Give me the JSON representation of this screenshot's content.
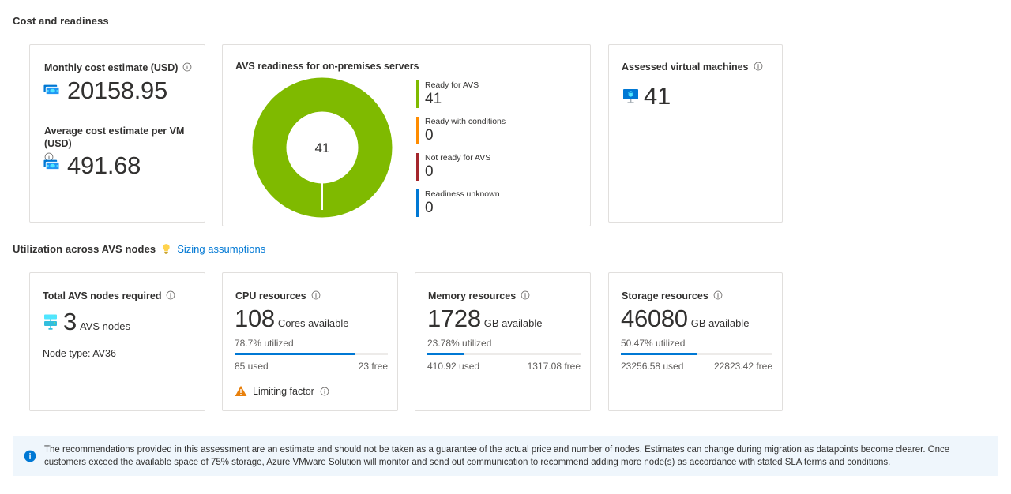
{
  "sections": {
    "cost": {
      "title": "Cost and readiness"
    },
    "utilization": {
      "title": "Utilization across AVS nodes",
      "link_label": "Sizing assumptions",
      "bulb_icon": "lightbulb-icon"
    }
  },
  "cost_card": {
    "monthly_label": "Monthly cost estimate (USD)",
    "monthly_value": "20158.95",
    "avg_label": "Average cost estimate per VM (USD)",
    "avg_value": "491.68",
    "money_icon": "money-icon",
    "info_icon": "info-icon"
  },
  "readiness_card": {
    "title": "AVS readiness for on-premises servers",
    "center_value": "41"
  },
  "assessed_card": {
    "label": "Assessed virtual machines",
    "value": "41",
    "vm_icon": "virtual-machine-icon"
  },
  "nodes_card": {
    "label": "Total AVS nodes required",
    "value": "3",
    "unit": "AVS nodes",
    "node_type": "Node type: AV36",
    "node_icon": "server-nodes-icon"
  },
  "cpu_card": {
    "label": "CPU resources",
    "value": "108",
    "unit": "Cores available",
    "utilized": "78.7% utilized",
    "used": "85 used",
    "free": "23 free",
    "limiting_label": "Limiting factor",
    "warning_icon": "warning-triangle-icon"
  },
  "memory_card": {
    "label": "Memory resources",
    "value": "1728",
    "unit": "GB available",
    "utilized": "23.78% utilized",
    "used": "410.92 used",
    "free": "1317.08 free"
  },
  "storage_card": {
    "label": "Storage resources",
    "value": "46080",
    "unit": "GB available",
    "utilized": "50.47% utilized",
    "used": "23256.58 used",
    "free": "22823.42 free"
  },
  "banner": {
    "icon": "info-filled-icon",
    "text": "The recommendations provided in this assessment are an estimate and should not be taken as a guarantee of the actual price and number of nodes. Estimates can change during migration as datapoints become clearer. Once customers exceed the available space of 75% storage, Azure VMware Solution will monitor and send out communication to recommend adding more node(s) as accordance with stated SLA terms and conditions."
  },
  "colors": {
    "green": "#7FBA00",
    "orange": "#FF8C00",
    "red": "#A4262C",
    "blue": "#0078D4",
    "track": "#EDEBE9",
    "banner_bg": "#EFF6FC"
  },
  "chart_data": {
    "type": "pie",
    "title": "AVS readiness for on-premises servers",
    "center_label": "41",
    "legend_position": "right",
    "categories": [
      "Ready for AVS",
      "Ready with conditions",
      "Not ready for AVS",
      "Readiness unknown"
    ],
    "values": [
      41,
      0,
      0,
      0
    ],
    "colors": [
      "#7FBA00",
      "#FF8C00",
      "#A4262C",
      "#0078D4"
    ],
    "total": 41
  },
  "bars": {
    "cpu_pct": 78.7,
    "memory_pct": 23.78,
    "storage_pct": 50.47
  }
}
